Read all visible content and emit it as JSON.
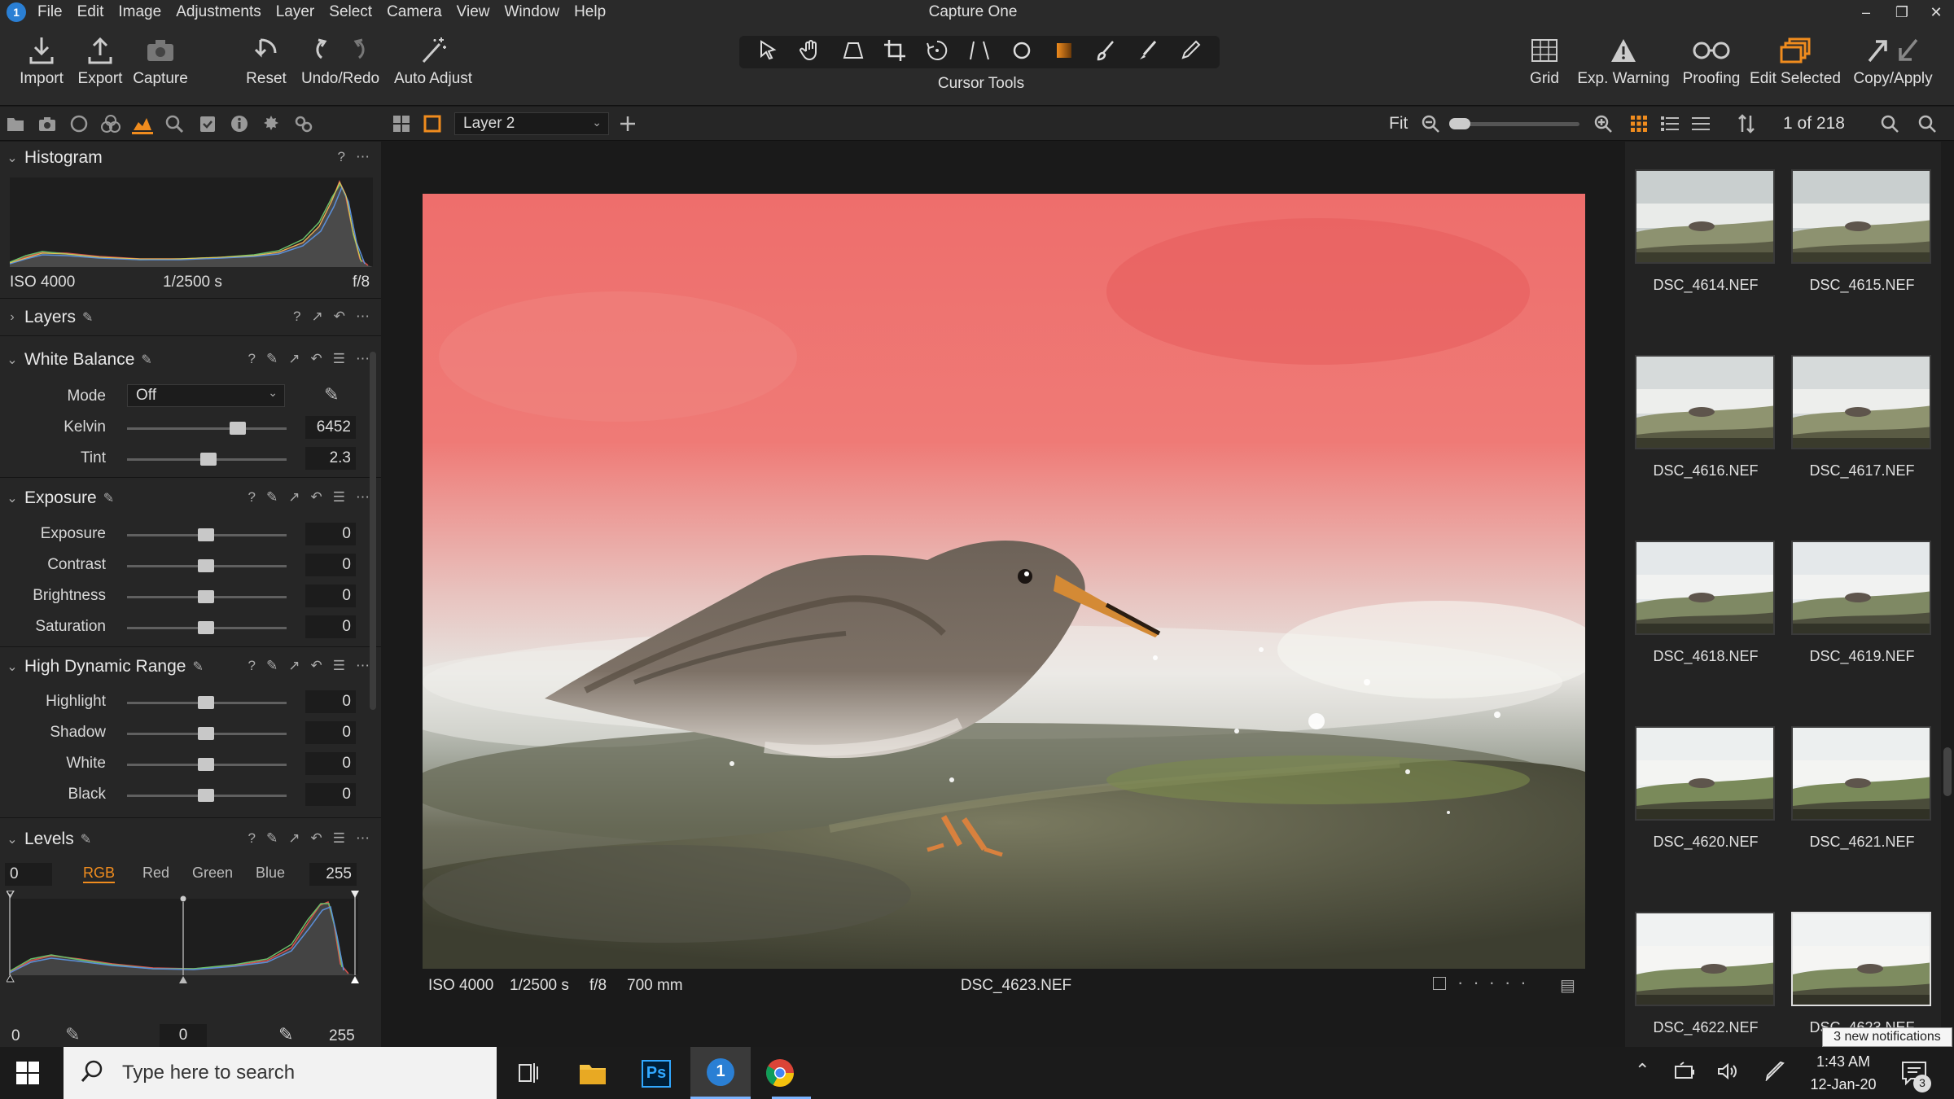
{
  "app": {
    "title": "Capture One"
  },
  "menu": [
    "File",
    "Edit",
    "Image",
    "Adjustments",
    "Layer",
    "Select",
    "Camera",
    "View",
    "Window",
    "Help"
  ],
  "toolbar": {
    "import": "Import",
    "export": "Export",
    "capture": "Capture",
    "reset": "Reset",
    "undo_redo": "Undo/Redo",
    "auto_adjust": "Auto Adjust",
    "cursor_tools": "Cursor Tools",
    "grid": "Grid",
    "exp_warning": "Exp. Warning",
    "proofing": "Proofing",
    "edit_selected": "Edit Selected",
    "copy_apply": "Copy/Apply"
  },
  "subbar": {
    "layer": "Layer 2",
    "zoom": "Fit",
    "counter": "1 of 218"
  },
  "histogram": {
    "title": "Histogram",
    "iso": "ISO 4000",
    "shutter": "1/2500 s",
    "aperture": "f/8"
  },
  "layers": {
    "title": "Layers"
  },
  "white_balance": {
    "title": "White Balance",
    "mode_label": "Mode",
    "mode_value": "Off",
    "kelvin_label": "Kelvin",
    "kelvin_value": "6452",
    "tint_label": "Tint",
    "tint_value": "2.3"
  },
  "exposure": {
    "title": "Exposure",
    "rows": [
      {
        "label": "Exposure",
        "value": "0"
      },
      {
        "label": "Contrast",
        "value": "0"
      },
      {
        "label": "Brightness",
        "value": "0"
      },
      {
        "label": "Saturation",
        "value": "0"
      }
    ]
  },
  "hdr": {
    "title": "High Dynamic Range",
    "rows": [
      {
        "label": "Highlight",
        "value": "0"
      },
      {
        "label": "Shadow",
        "value": "0"
      },
      {
        "label": "White",
        "value": "0"
      },
      {
        "label": "Black",
        "value": "0"
      }
    ]
  },
  "levels": {
    "title": "Levels",
    "in_low": "0",
    "in_high": "255",
    "channels": [
      "RGB",
      "Red",
      "Green",
      "Blue"
    ],
    "out_low": "0",
    "mid": "0",
    "out_high": "255"
  },
  "viewer": {
    "iso": "ISO 4000",
    "shutter": "1/2500 s",
    "aperture": "f/8",
    "focal": "700 mm",
    "filename": "DSC_4623.NEF"
  },
  "browser": {
    "thumbs": [
      "DSC_4614.NEF",
      "DSC_4615.NEF",
      "DSC_4616.NEF",
      "DSC_4617.NEF",
      "DSC_4618.NEF",
      "DSC_4619.NEF",
      "DSC_4620.NEF",
      "DSC_4621.NEF",
      "DSC_4622.NEF",
      "DSC_4623.NEF"
    ]
  },
  "taskbar": {
    "search_placeholder": "Type here to search",
    "time": "1:43 AM",
    "date": "12-Jan-20",
    "notifications": "3 new notifications",
    "notif_count": "3"
  },
  "colors": {
    "accent": "#f08c1e",
    "panel_bg": "#262626",
    "toolbar_bg": "#2a2a2a"
  }
}
